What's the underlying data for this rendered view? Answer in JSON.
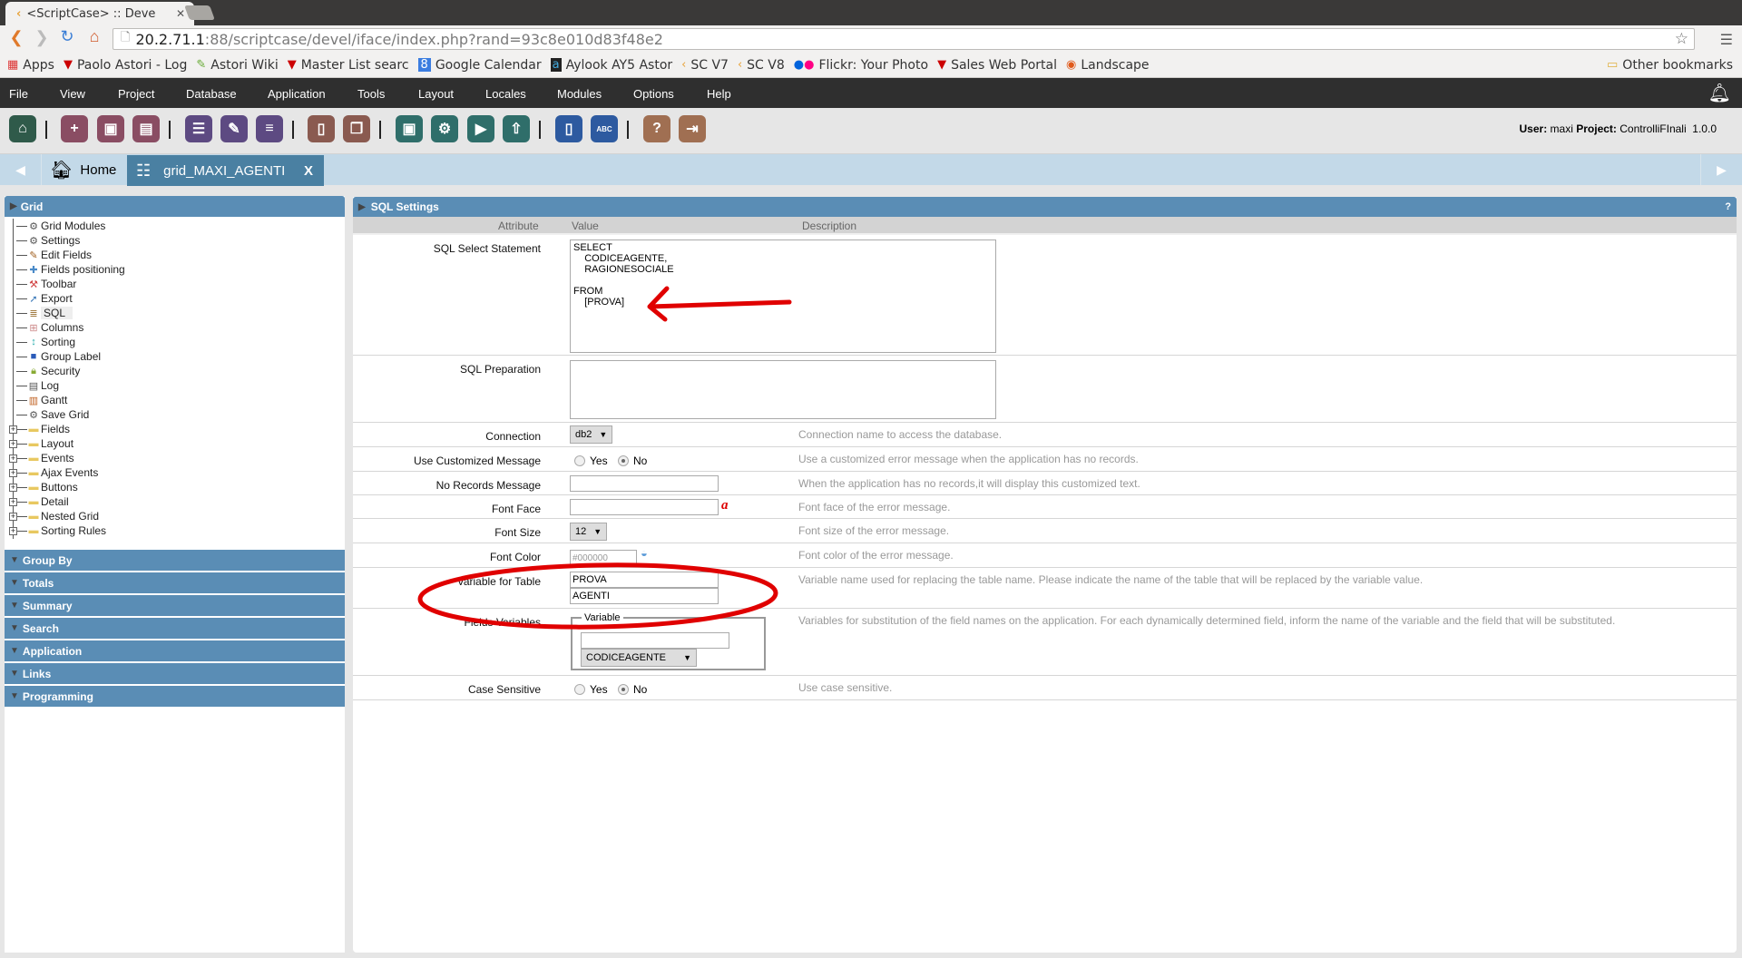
{
  "browser": {
    "tab_title": "<ScriptCase> :: Deve",
    "url_host": "20.2.71.1",
    "url_rest": ":88/scriptcase/devel/iface/index.php?rand=93c8e010d83f48e2",
    "bookmarks": [
      {
        "icon": "apps-icon",
        "label": "Apps"
      },
      {
        "icon": "vodafone-icon",
        "label": "Paolo Astori - Log"
      },
      {
        "icon": "wiki-icon",
        "label": "Astori Wiki"
      },
      {
        "icon": "vodafone-icon",
        "label": "Master List searc"
      },
      {
        "icon": "calendar-icon",
        "label": "Google Calendar"
      },
      {
        "icon": "aylook-icon",
        "label": "Aylook AY5 Astor"
      },
      {
        "icon": "scriptcase-icon",
        "label": "SC V7"
      },
      {
        "icon": "scriptcase-icon",
        "label": "SC V8"
      },
      {
        "icon": "flickr-icon",
        "label": "Flickr: Your Photo"
      },
      {
        "icon": "vodafone-icon",
        "label": "Sales Web Portal"
      },
      {
        "icon": "ubuntu-icon",
        "label": "Landscape"
      }
    ],
    "other_bookmarks": "Other bookmarks"
  },
  "menu": [
    "File",
    "View",
    "Project",
    "Database",
    "Application",
    "Tools",
    "Layout",
    "Locales",
    "Modules",
    "Options",
    "Help"
  ],
  "user_info": {
    "user_label": "User:",
    "user": "maxi",
    "project_label": "Project:",
    "project": "ControlliFInali",
    "version": "1.0.0"
  },
  "tabs": {
    "home": "Home",
    "active": "grid_MAXI_AGENTI",
    "close": "X"
  },
  "left_panel": {
    "title": "Grid",
    "items": [
      {
        "icon": "gear-icon",
        "label": "Grid Modules"
      },
      {
        "icon": "gear-icon",
        "label": "Settings"
      },
      {
        "icon": "pencil-icon",
        "label": "Edit Fields"
      },
      {
        "icon": "move-icon",
        "label": "Fields positioning"
      },
      {
        "icon": "toolbar-icon",
        "label": "Toolbar"
      },
      {
        "icon": "export-icon",
        "label": "Export"
      },
      {
        "icon": "sql-icon",
        "label": "SQL"
      },
      {
        "icon": "columns-icon",
        "label": "Columns"
      },
      {
        "icon": "sorting-icon",
        "label": "Sorting"
      },
      {
        "icon": "group-label-icon",
        "label": "Group Label"
      },
      {
        "icon": "lock-icon",
        "label": "Security"
      },
      {
        "icon": "log-icon",
        "label": "Log"
      },
      {
        "icon": "gantt-icon",
        "label": "Gantt"
      },
      {
        "icon": "gear-icon",
        "label": "Save Grid"
      }
    ],
    "folders": [
      "Fields",
      "Layout",
      "Events",
      "Ajax Events",
      "Buttons",
      "Detail",
      "Nested Grid",
      "Sorting Rules"
    ],
    "sections": [
      "Group By",
      "Totals",
      "Summary",
      "Search",
      "Application",
      "Links",
      "Programming"
    ]
  },
  "sql_settings": {
    "title": "SQL Settings",
    "help": "?",
    "columns": {
      "attribute": "Attribute",
      "value": "Value",
      "description": "Description"
    },
    "sql_select": {
      "label": "SQL Select Statement",
      "value": "SELECT\n    CODICEAGENTE,\n    RAGIONESOCIALE\n\nFROM\n    [PROVA]"
    },
    "sql_preparation": {
      "label": "SQL Preparation",
      "value": ""
    },
    "connection": {
      "label": "Connection",
      "value": "db2",
      "description": "Connection name to access the database."
    },
    "custom_message": {
      "label": "Use Customized Message",
      "yes": "Yes",
      "no": "No",
      "selected": "No",
      "description": "Use a customized error message when the application has no records."
    },
    "no_records": {
      "label": "No Records Message",
      "value": "",
      "description": "When the application has no records,it will display this customized text."
    },
    "font_face": {
      "label": "Font Face",
      "value": "",
      "description": "Font face of the error message."
    },
    "font_size": {
      "label": "Font Size",
      "value": "12",
      "description": "Font size of the error message."
    },
    "font_color": {
      "label": "Font Color",
      "value": "#000000",
      "description": "Font color of the error message."
    },
    "variable_table": {
      "label": "Variable for Table",
      "value1": "PROVA",
      "value2": "AGENTI",
      "description": "Variable name used for replacing the table name. Please indicate the name of the table that will be replaced by the variable value."
    },
    "fields_variables": {
      "label": "Fields Variables",
      "legend": "Variable",
      "value": "",
      "field": "CODICEAGENTE",
      "description": "Variables for substitution of the field names on the application. For each dynamically determined field, inform the name of the variable and the field that will be substituted."
    },
    "case_sensitive": {
      "label": "Case Sensitive",
      "yes": "Yes",
      "no": "No",
      "selected": "No",
      "description": "Use case sensitive."
    }
  },
  "annotation_color": "#e00000"
}
